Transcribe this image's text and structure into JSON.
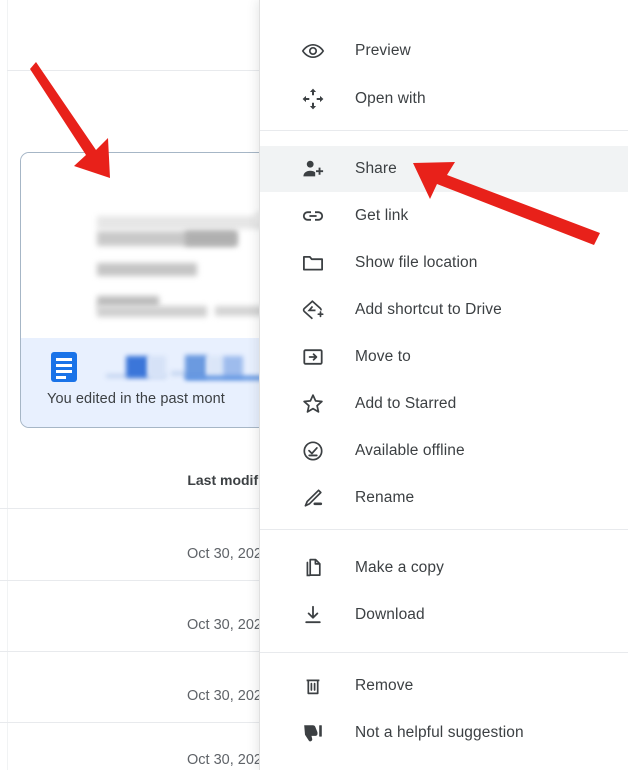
{
  "card": {
    "caption": "You edited in the past mont",
    "icon": "google-docs-icon",
    "selected": true,
    "border_color": "#a6b6c6",
    "background_color": "#e8f0fe"
  },
  "file_list": {
    "column_header": "Last modifi",
    "rows": [
      {
        "modified": "Oct 30, 202"
      },
      {
        "modified": "Oct 30, 202"
      },
      {
        "modified": "Oct 30, 202"
      },
      {
        "modified": "Oct 30, 202"
      }
    ]
  },
  "context_menu": {
    "highlight_color": "#f1f3f4",
    "items": [
      {
        "label": "Preview",
        "icon": "eye-icon",
        "group": 1
      },
      {
        "label": "Open with",
        "icon": "move-arrows-icon",
        "group": 1
      },
      {
        "label": "Share",
        "icon": "person-add-icon",
        "group": 2,
        "highlighted": true
      },
      {
        "label": "Get link",
        "icon": "link-icon",
        "group": 2
      },
      {
        "label": "Show file location",
        "icon": "folder-icon",
        "group": 2
      },
      {
        "label": "Add shortcut to Drive",
        "icon": "drive-add-icon",
        "group": 2
      },
      {
        "label": "Move to",
        "icon": "folder-arrow-icon",
        "group": 2
      },
      {
        "label": "Add to Starred",
        "icon": "star-icon",
        "group": 2
      },
      {
        "label": "Available offline",
        "icon": "check-circle-icon",
        "group": 2
      },
      {
        "label": "Rename",
        "icon": "pencil-icon",
        "group": 2
      },
      {
        "label": "Make a copy",
        "icon": "copy-icon",
        "group": 3
      },
      {
        "label": "Download",
        "icon": "download-icon",
        "group": 3
      },
      {
        "label": "Remove",
        "icon": "trash-icon",
        "group": 4
      },
      {
        "label": "Not a helpful suggestion",
        "icon": "thumb-down-icon",
        "group": 4
      }
    ]
  },
  "annotations": {
    "color": "#e8211a",
    "arrows": [
      {
        "name": "arrow-to-file-card",
        "points_at": "file-card"
      },
      {
        "name": "arrow-to-share-item",
        "points_at": "menu-item-share"
      }
    ]
  }
}
